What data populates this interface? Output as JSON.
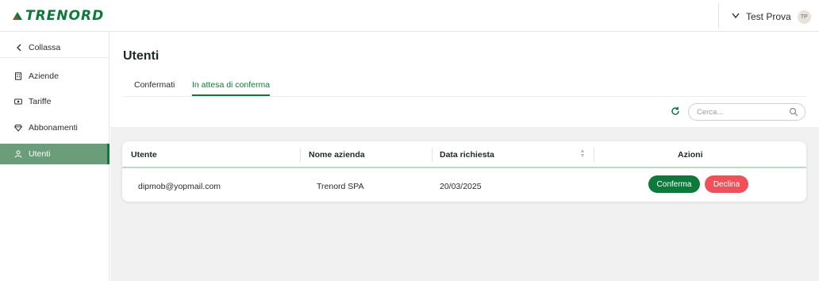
{
  "header": {
    "logo_text": "TRENORD",
    "user_name": "Test Prova",
    "avatar_initials": "TP",
    "brand_color": "#0d7a3b"
  },
  "sidebar": {
    "items": [
      {
        "label": "Collassa",
        "icon": "chevron-left-icon"
      },
      {
        "label": "Aziende",
        "icon": "building-icon"
      },
      {
        "label": "Tariffe",
        "icon": "ticket-icon"
      },
      {
        "label": "Abbonamenti",
        "icon": "diamond-icon"
      },
      {
        "label": "Utenti",
        "icon": "user-icon",
        "active": true
      }
    ]
  },
  "main": {
    "title": "Utenti",
    "tabs": [
      {
        "label": "Confermati"
      },
      {
        "label": "In attesa di conferma",
        "active": true
      }
    ],
    "search": {
      "placeholder": "Cerca..."
    },
    "table": {
      "columns": [
        "Utente",
        "Nome azienda",
        "Data richiesta",
        "Azioni"
      ],
      "rows": [
        {
          "utente": "dipmob@yopmail.com",
          "nome_azienda": "Trenord SPA",
          "data_richiesta": "20/03/2025",
          "confirm_label": "Conferma",
          "decline_label": "Declina"
        }
      ]
    }
  },
  "colors": {
    "accent": "#0d7a3b",
    "sidebar_active": "#6c9d7b",
    "decline": "#f0505a"
  }
}
